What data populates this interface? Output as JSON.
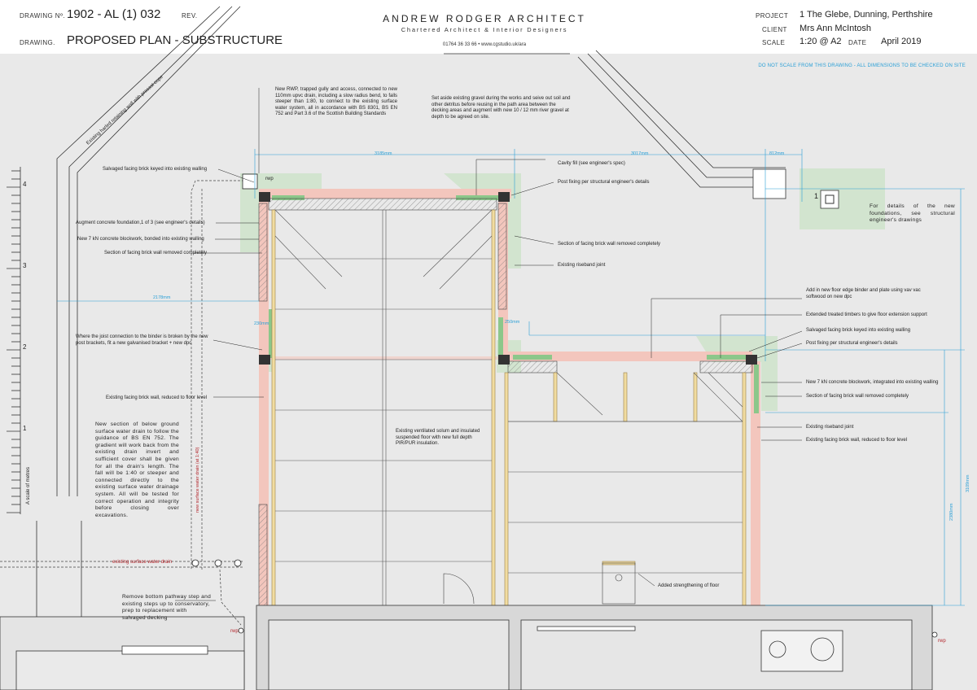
{
  "title_block": {
    "drawing_no_label": "DRAWING Nº.",
    "drawing_no": "1902 - AL (1) 032",
    "rev_label": "REV.",
    "drawing_label": "DRAWING.",
    "drawing_title": "PROPOSED PLAN - SUBSTRUCTURE",
    "firm_name": "ANDREW RODGER ARCHITECT",
    "firm_tagline": "Chartered Architect & Interior Designers",
    "firm_contact": "01764 36 33 66  •  www.cgstudio.uk/ara",
    "project_label": "PROJECT",
    "project": "1 The Glebe, Dunning, Perthshire",
    "client_label": "CLIENT",
    "client": "Mrs Ann McIntosh",
    "scale_label": "SCALE",
    "scale": "1:20 @ A2",
    "date_label": "DATE",
    "date": "April 2019"
  },
  "warning": "DO NOT SCALE FROM THIS DRAWING - ALL DIMENSIONS TO BE CHECKED ON SITE",
  "notes": {
    "rwp": "New RWP, trapped gully and access, connected to new 110mm upvc drain, including a slow radius bend, to falls steeper than 1:80, to connect to the existing surface water system, all in accordance with BS 8301, BS EN 752 and Part 3.6 of the Scottish Building Standards",
    "gravel": "Set aside existing gravel during the works and seive out soil and other detritus before reusing in the path area between the decking areas and augment with new 10 / 12 mm river gravel at depth to be agreed on site.",
    "salvaged_left": "Salvaged facing brick keyed into existing walling",
    "augment": "Augment concrete foundation,1 of 3 (see engineer's details)",
    "blockwork_left": "New 7 kN concrete blockwork, bonded into existing walling",
    "removed_left": "Section of facing brick wall removed completely",
    "joist": "Where the joist connection to the binder is broken by the new post brackets, fit a new galvanised bracket + new dpc",
    "reduced_left": "Existing facing brick wall, reduced to floor level",
    "drain": "New section of below ground surface water drain to follow the guidance of BS EN 752. The gradient will work back from the existing drain invert and sufficient cover shall be given for all the drain's length. The fall will be 1:40 or steeper and connected directly to the existing surface water drainage system. All will be tested for correct operation and integrity before closing over excavations.",
    "remove_step": "Remove bottom pathway step and existing steps up to conservatory, prep to replacement with salvaged decking",
    "cavity": "Cavity fill (see engineer's spec)",
    "post_fixing_top": "Post fixing per structural engineer's details",
    "removed_mid": "Section of facing brick wall removed completely",
    "riseband_mid": "Existing riseband joint",
    "solum": "Existing ventilated solum and insulated suspended floor with new full depth PIR/PUR insulation.",
    "foundations": "For details of the new foundations, see structural engineer's drawings",
    "binder": "Add in new floor edge binder and plate using vav vac softwood on new dpc",
    "extended": "Extended treated timbers to give floor extension support",
    "salvaged_right": "Salvaged facing brick keyed into existing walling",
    "post_fixing_right": "Post fixing per structural engineer's details",
    "blockwork_right": "New 7 kN concrete blockwork, integrated into existing walling",
    "removed_right": "Section of facing brick wall removed completely",
    "riseband_right": "Existing riseband joint",
    "reduced_right": "Existing facing brick wall, reduced to floor level",
    "strengthening": "Added strengthening of floor"
  },
  "labels": {
    "retaining_wall": "Existing harled retaining wall with precast cope",
    "surface_drain_1": "existing surface water drain",
    "surface_drain_2": "existing surface water drain",
    "new_drain": "new surface water drain (at 1:40)",
    "rwp_1": "rwp",
    "rwp_2": "rwp",
    "rwp_3": "rwp",
    "foundation_marker": "1",
    "scale_caption": "A scale of metres"
  },
  "scale_bar": {
    "ticks": [
      "4",
      "3",
      "2",
      "1"
    ]
  },
  "dimensions": {
    "d3185": "3185mm",
    "d3017": "3017mm",
    "d812": "812mm",
    "d2178": "2178mm",
    "d1968": "1968mm",
    "d2380": "2380mm",
    "d3109": "3109mm",
    "d_small_1": "230mm",
    "d_small_2": "250mm"
  },
  "colors": {
    "dimension": "#2a9fd6",
    "brick_removed": "#f3c6bd",
    "foundation": "#cfe3cc",
    "blockwork": "#8cc78a",
    "timber": "#f1dca0",
    "drain_label": "#b3262c"
  }
}
